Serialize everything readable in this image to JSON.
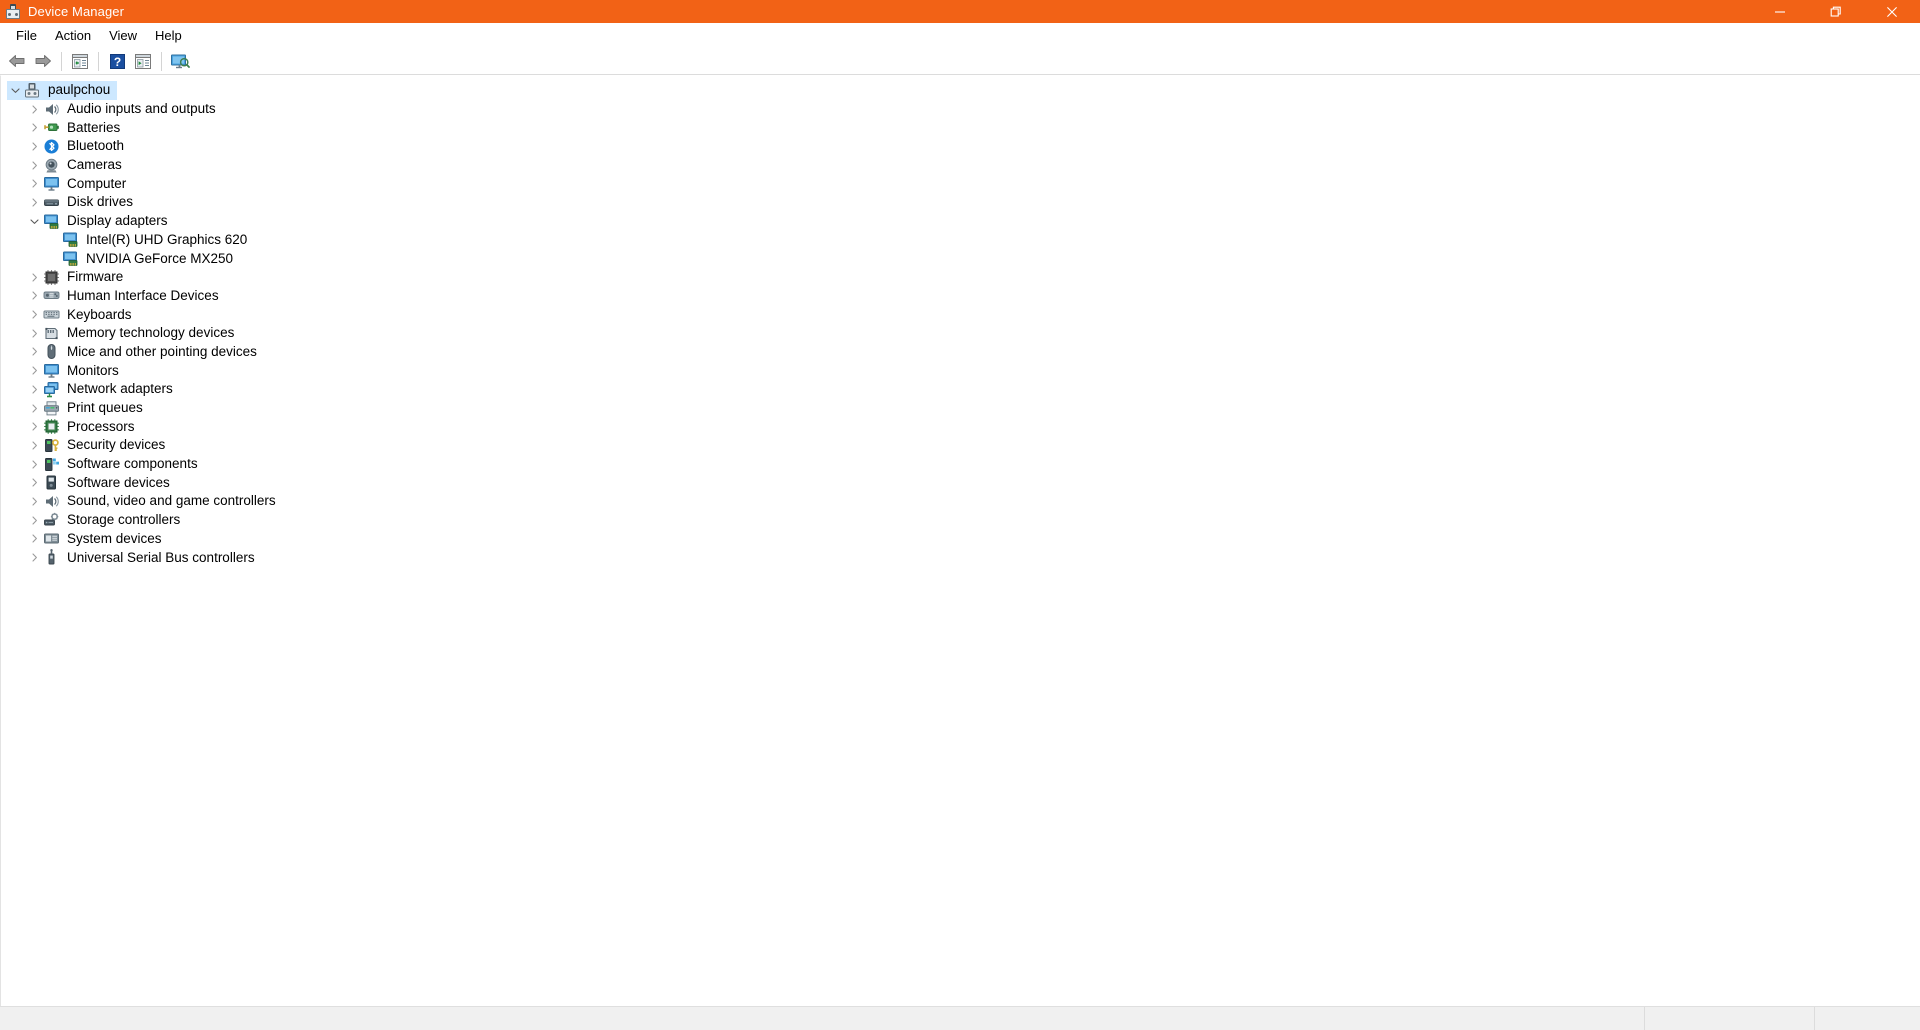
{
  "window": {
    "title": "Device Manager",
    "title_icon": "device-manager-icon",
    "accent_color": "#f26216",
    "controls": {
      "minimize": "minimize-icon",
      "maximize": "restore-icon",
      "close": "close-icon"
    }
  },
  "menubar": {
    "items": [
      {
        "label": "File"
      },
      {
        "label": "Action"
      },
      {
        "label": "View"
      },
      {
        "label": "Help"
      }
    ]
  },
  "toolbar": {
    "buttons": [
      {
        "name": "back-button",
        "icon": "back-arrow-icon"
      },
      {
        "name": "forward-button",
        "icon": "forward-arrow-icon"
      },
      {
        "name": "separator-1",
        "icon": "separator"
      },
      {
        "name": "show-hide-console-tree-button",
        "icon": "console-tree-icon"
      },
      {
        "name": "separator-2",
        "icon": "separator"
      },
      {
        "name": "help-button",
        "icon": "question-mark-icon"
      },
      {
        "name": "properties-button",
        "icon": "properties-panel-icon"
      },
      {
        "name": "separator-3",
        "icon": "separator"
      },
      {
        "name": "scan-for-hardware-changes-button",
        "icon": "monitor-scan-icon"
      }
    ]
  },
  "tree": {
    "selection_color": "#cde8ff",
    "root": {
      "label": "paulpchou",
      "icon": "computer-node-icon",
      "expanded": true,
      "selected": true,
      "indent": 0
    },
    "nodes": [
      {
        "label": "Audio inputs and outputs",
        "icon": "speaker-icon",
        "expanded": false,
        "has_children": true,
        "indent": 1
      },
      {
        "label": "Batteries",
        "icon": "battery-icon",
        "expanded": false,
        "has_children": true,
        "indent": 1
      },
      {
        "label": "Bluetooth",
        "icon": "bluetooth-icon",
        "expanded": false,
        "has_children": true,
        "indent": 1
      },
      {
        "label": "Cameras",
        "icon": "camera-icon",
        "expanded": false,
        "has_children": true,
        "indent": 1
      },
      {
        "label": "Computer",
        "icon": "monitor-icon",
        "expanded": false,
        "has_children": true,
        "indent": 1
      },
      {
        "label": "Disk drives",
        "icon": "disk-drive-icon",
        "expanded": false,
        "has_children": true,
        "indent": 1
      },
      {
        "label": "Display adapters",
        "icon": "display-adapter-icon",
        "expanded": true,
        "has_children": true,
        "indent": 1
      },
      {
        "label": "Intel(R) UHD Graphics 620",
        "icon": "display-adapter-icon",
        "expanded": false,
        "has_children": false,
        "indent": 2
      },
      {
        "label": "NVIDIA GeForce MX250",
        "icon": "display-adapter-icon",
        "expanded": false,
        "has_children": false,
        "indent": 2
      },
      {
        "label": "Firmware",
        "icon": "firmware-chip-icon",
        "expanded": false,
        "has_children": true,
        "indent": 1
      },
      {
        "label": "Human Interface Devices",
        "icon": "hid-icon",
        "expanded": false,
        "has_children": true,
        "indent": 1
      },
      {
        "label": "Keyboards",
        "icon": "keyboard-icon",
        "expanded": false,
        "has_children": true,
        "indent": 1
      },
      {
        "label": "Memory technology devices",
        "icon": "memory-card-icon",
        "expanded": false,
        "has_children": true,
        "indent": 1
      },
      {
        "label": "Mice and other pointing devices",
        "icon": "mouse-icon",
        "expanded": false,
        "has_children": true,
        "indent": 1
      },
      {
        "label": "Monitors",
        "icon": "monitor-icon",
        "expanded": false,
        "has_children": true,
        "indent": 1
      },
      {
        "label": "Network adapters",
        "icon": "network-adapter-icon",
        "expanded": false,
        "has_children": true,
        "indent": 1
      },
      {
        "label": "Print queues",
        "icon": "printer-icon",
        "expanded": false,
        "has_children": true,
        "indent": 1
      },
      {
        "label": "Processors",
        "icon": "processor-icon",
        "expanded": false,
        "has_children": true,
        "indent": 1
      },
      {
        "label": "Security devices",
        "icon": "security-key-icon",
        "expanded": false,
        "has_children": true,
        "indent": 1
      },
      {
        "label": "Software components",
        "icon": "software-component-icon",
        "expanded": false,
        "has_children": true,
        "indent": 1
      },
      {
        "label": "Software devices",
        "icon": "software-device-icon",
        "expanded": false,
        "has_children": true,
        "indent": 1
      },
      {
        "label": "Sound, video and game controllers",
        "icon": "sound-controller-icon",
        "expanded": false,
        "has_children": true,
        "indent": 1
      },
      {
        "label": "Storage controllers",
        "icon": "storage-controller-icon",
        "expanded": false,
        "has_children": true,
        "indent": 1
      },
      {
        "label": "System devices",
        "icon": "system-device-icon",
        "expanded": false,
        "has_children": true,
        "indent": 1
      },
      {
        "label": "Universal Serial Bus controllers",
        "icon": "usb-controller-icon",
        "expanded": false,
        "has_children": true,
        "indent": 1
      }
    ]
  },
  "statusbar": {
    "panes": [
      {
        "text": ""
      },
      {
        "text": ""
      },
      {
        "text": ""
      }
    ]
  }
}
